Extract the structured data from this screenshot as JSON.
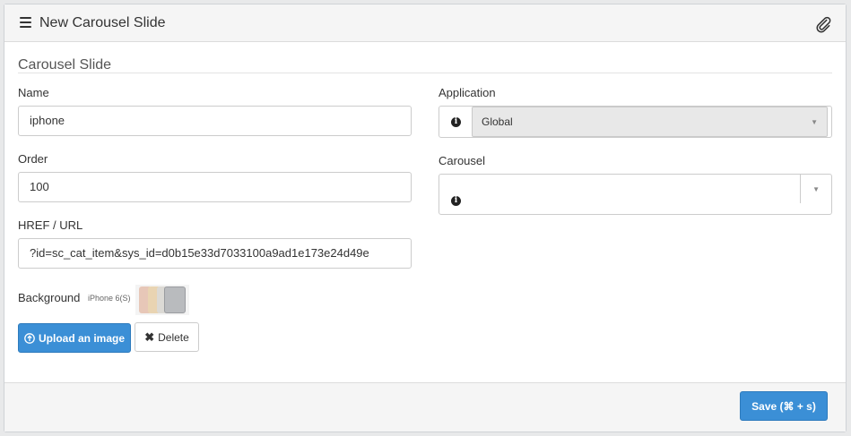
{
  "header": {
    "title": "New Carousel Slide"
  },
  "section": {
    "title": "Carousel Slide"
  },
  "fields": {
    "name": {
      "label": "Name",
      "value": "iphone"
    },
    "order": {
      "label": "Order",
      "value": "100"
    },
    "href": {
      "label": "HREF / URL",
      "value": "?id=sc_cat_item&sys_id=d0b15e33d7033100a9ad1e173e24d49e"
    },
    "application": {
      "label": "Application",
      "value": "Global"
    },
    "carousel": {
      "label": "Carousel",
      "value": ""
    },
    "background": {
      "label": "Background",
      "image_caption": "iPhone 6(S)"
    }
  },
  "buttons": {
    "upload": "Upload an image",
    "delete": "Delete",
    "save": "Save (⌘ + s)"
  },
  "colors": {
    "primary": "#3b8fd6",
    "header_bg": "#f5f5f5"
  }
}
